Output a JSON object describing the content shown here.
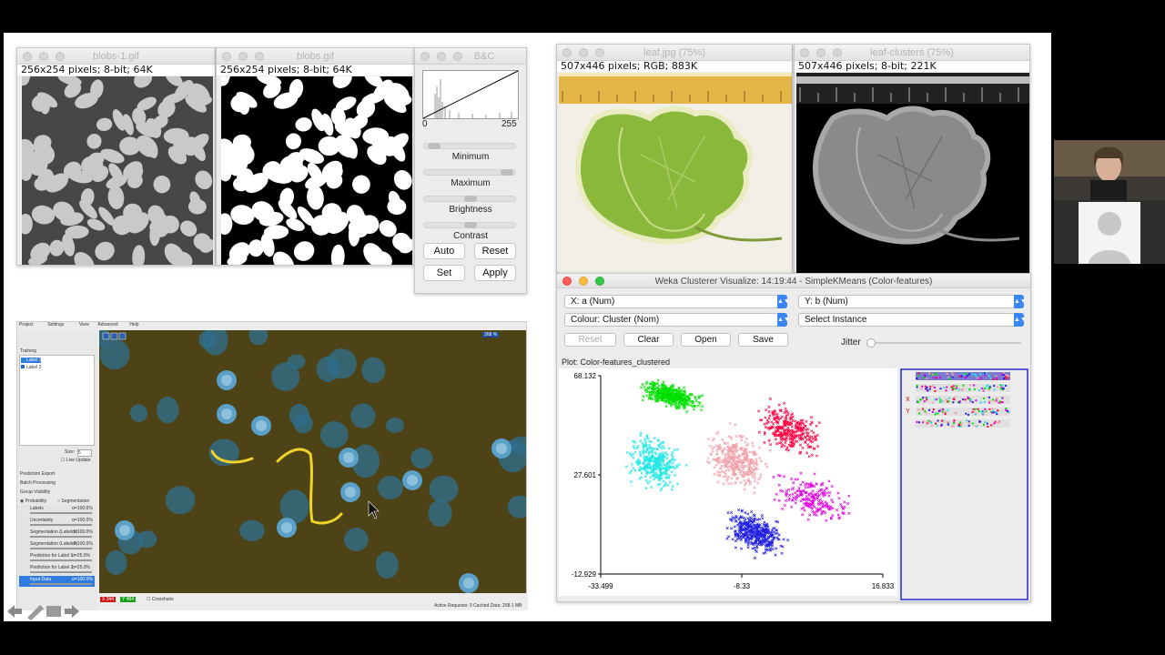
{
  "imagej": {
    "blobs1": {
      "title": "blobs-1.gif",
      "info": "256x254 pixels; 8-bit; 64K"
    },
    "blobs": {
      "title": "blobs.gif",
      "info": "256x254 pixels; 8-bit; 64K"
    },
    "bc": {
      "title": "B&C",
      "hist_min": "0",
      "hist_max": "255",
      "labels": [
        "Minimum",
        "Maximum",
        "Brightness",
        "Contrast"
      ],
      "levels": [
        0.05,
        0.95,
        0.5,
        0.5
      ],
      "buttons": {
        "auto": "Auto",
        "reset": "Reset",
        "set": "Set",
        "apply": "Apply"
      }
    },
    "leaf": {
      "title": "leaf.jpg (75%)",
      "info": "507x446 pixels; RGB; 883K"
    },
    "leafclusters": {
      "title": "leaf-clusters (75%)",
      "info": "507x446 pixels; 8-bit; 221K"
    }
  },
  "ilastik": {
    "menu": [
      "Project",
      "Settings",
      "View",
      "Advanced",
      "Help"
    ],
    "training_label": "Training",
    "labels": [
      "Label 1",
      "Label 2"
    ],
    "label_colors": [
      "#1d8de0",
      "#1c6dd0"
    ],
    "size_label": "Size:",
    "size_value": "5",
    "live_update": "Live Update",
    "sections": [
      "Prediction Export",
      "Batch Processing",
      "Group Visibility"
    ],
    "probability": "Probability",
    "segmentation": "Segmentation",
    "layers": [
      {
        "name": "Labels",
        "pct": "α=100.0%"
      },
      {
        "name": "Uncertainty",
        "pct": "α=100.0%"
      },
      {
        "name": "Segmentation (Label 1)",
        "pct": "α=100.0%"
      },
      {
        "name": "Segmentation (Label 2)",
        "pct": "α=100.0%"
      },
      {
        "name": "Prediction for Label 1",
        "pct": "α=25.0%"
      },
      {
        "name": "Prediction for Label 2",
        "pct": "α=25.0%"
      },
      {
        "name": "Input Data",
        "pct": "α=100.0%"
      }
    ],
    "zoom": "268 %",
    "coord_x": "344",
    "coord_y": "484",
    "crosshairs": "Crosshairs",
    "status": "Active Requests: 0 Cached Data: 268.1 MB"
  },
  "weka": {
    "title": "Weka Clusterer Visualize: 14:19:44 - SimpleKMeans (Color-features)",
    "x_select": "X: a (Num)",
    "y_select": "Y: b (Num)",
    "colour_select": "Colour: Cluster (Nom)",
    "instance_select": "Select Instance",
    "buttons": {
      "reset": "Reset",
      "clear": "Clear",
      "open": "Open",
      "save": "Save"
    },
    "jitter": "Jitter",
    "plot_title": "Plot: Color-features_clustered",
    "legend_x": "X",
    "legend_y": "Y"
  },
  "chart_data": {
    "type": "scatter",
    "title": "Plot: Color-features_clustered",
    "xlim": [
      -33.499,
      16.833
    ],
    "ylim": [
      -12.929,
      68.132
    ],
    "x_ticks": [
      "-33.499",
      "-8.33",
      "16.833"
    ],
    "y_ticks": [
      "68.132",
      "27.601",
      "-12.929"
    ],
    "series": [
      {
        "color": "#00e000",
        "center": [
          -21,
          60
        ],
        "spread": [
          4.5,
          4
        ],
        "n": 460
      },
      {
        "color": "#20e6e6",
        "center": [
          -24,
          33
        ],
        "spread": [
          4,
          9
        ],
        "n": 340
      },
      {
        "color": "#f0a0a8",
        "center": [
          -9,
          33
        ],
        "spread": [
          4.5,
          10
        ],
        "n": 360
      },
      {
        "color": "#ff0040",
        "center": [
          0,
          46
        ],
        "spread": [
          5,
          8
        ],
        "n": 320
      },
      {
        "color": "#e000e0",
        "center": [
          4,
          18
        ],
        "spread": [
          6,
          8
        ],
        "n": 220
      },
      {
        "color": "#2020e0",
        "center": [
          -6,
          4
        ],
        "spread": [
          4.5,
          7
        ],
        "n": 420
      }
    ]
  },
  "nav_icons": [
    "back-arrow-icon",
    "pencil-icon",
    "slides-icon",
    "forward-arrow-icon"
  ]
}
